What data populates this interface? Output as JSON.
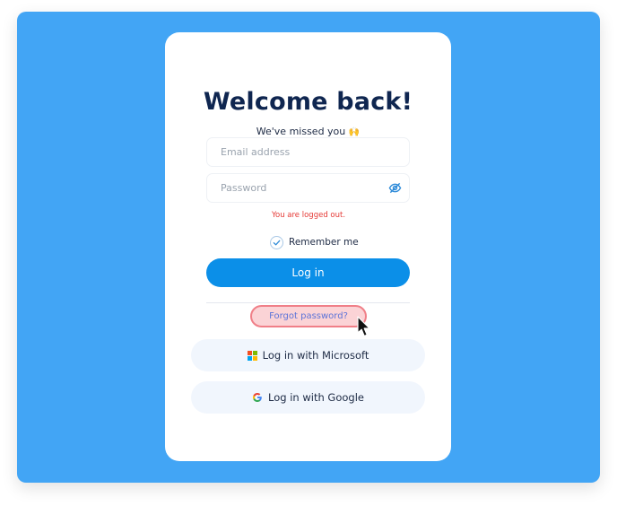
{
  "login": {
    "title": "Welcome back!",
    "subtitle": "We've missed you",
    "subtitle_emoji": "🙌",
    "email_placeholder": "Email address",
    "password_placeholder": "Password",
    "error_message": "You are logged out.",
    "remember_label": "Remember me",
    "remember_checked": true,
    "login_button": "Log in",
    "forgot_password": "Forgot password?",
    "microsoft_button": "Log in with Microsoft",
    "google_button": "Log in with Google"
  },
  "icons": {
    "password_toggle": "eye-off-icon",
    "remember_check": "checkmark-icon",
    "microsoft": "microsoft-logo-icon",
    "google": "google-logo-icon",
    "cursor": "mouse-pointer-icon"
  },
  "colors": {
    "background": "#42a5f5",
    "card": "#ffffff",
    "title": "#0f2650",
    "primary_button": "#0b8fe8",
    "error": "#e53935",
    "forgot_highlight_fill": "#fbd3d6",
    "forgot_highlight_border": "#f07f88",
    "social_button": "#f1f6fd"
  }
}
